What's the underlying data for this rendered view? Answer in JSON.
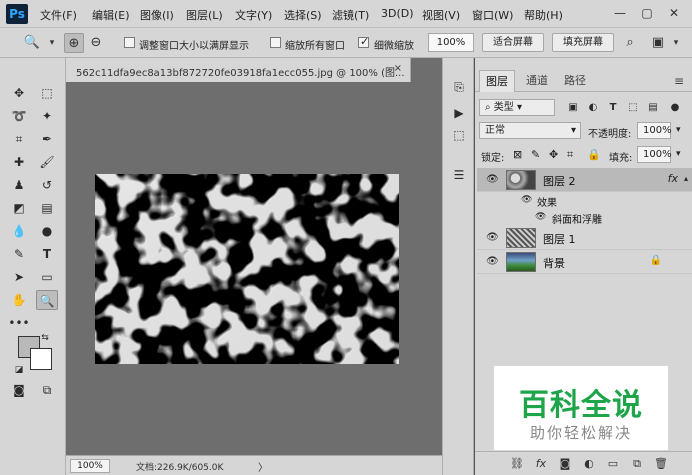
{
  "app": {
    "logo": "Ps"
  },
  "menu": [
    "文件(F)",
    "编辑(E)",
    "图像(I)",
    "图层(L)",
    "文字(Y)",
    "选择(S)",
    "滤镜(T)",
    "3D(D)",
    "视图(V)",
    "窗口(W)",
    "帮助(H)"
  ],
  "window_controls": {
    "minimize": "—",
    "restore": "▢",
    "close": "✕"
  },
  "options": {
    "resize_windows_label": "调整窗口大小以满屏显示",
    "resize_windows_checked": false,
    "zoom_all_label": "缩放所有窗口",
    "zoom_all_checked": false,
    "scrubby_zoom_label": "细微缩放",
    "scrubby_zoom_checked": true,
    "zoom_value": "100%",
    "fit_screen_label": "适合屏幕",
    "fill_screen_label": "填充屏幕"
  },
  "document": {
    "tab_title": "562c11dfa9ec8a13bf872720fe03918fa1ecc055.jpg @ 100% (图...",
    "close": "×",
    "zoom": "100%",
    "info": "文档:226.9K/605.0K",
    "info_arrow": "〉"
  },
  "layers_panel": {
    "tabs": [
      "图层",
      "通道",
      "路径"
    ],
    "active_tab": "图层",
    "filter_kind": "类型",
    "blend_mode": "正常",
    "opacity_label": "不透明度:",
    "opacity_value": "100%",
    "lock_label": "锁定:",
    "fill_label": "填充:",
    "fill_value": "100%",
    "layers": [
      {
        "name": "图层 2",
        "selected": true,
        "fx": "fx",
        "visible": true
      },
      {
        "name": "图层 1",
        "selected": false,
        "visible": true
      },
      {
        "name": "背景",
        "selected": false,
        "visible": true,
        "locked": true
      }
    ],
    "effects_label": "效果",
    "effect_name": "斜面和浮雕"
  },
  "watermark": {
    "title": "百科全说",
    "subtitle": "助你轻松解决"
  },
  "colors": {
    "foreground": "#b9b9b9",
    "background": "#ffffff",
    "brand_green": "#1ea54a",
    "ui_gray": "#d6d6d6"
  }
}
